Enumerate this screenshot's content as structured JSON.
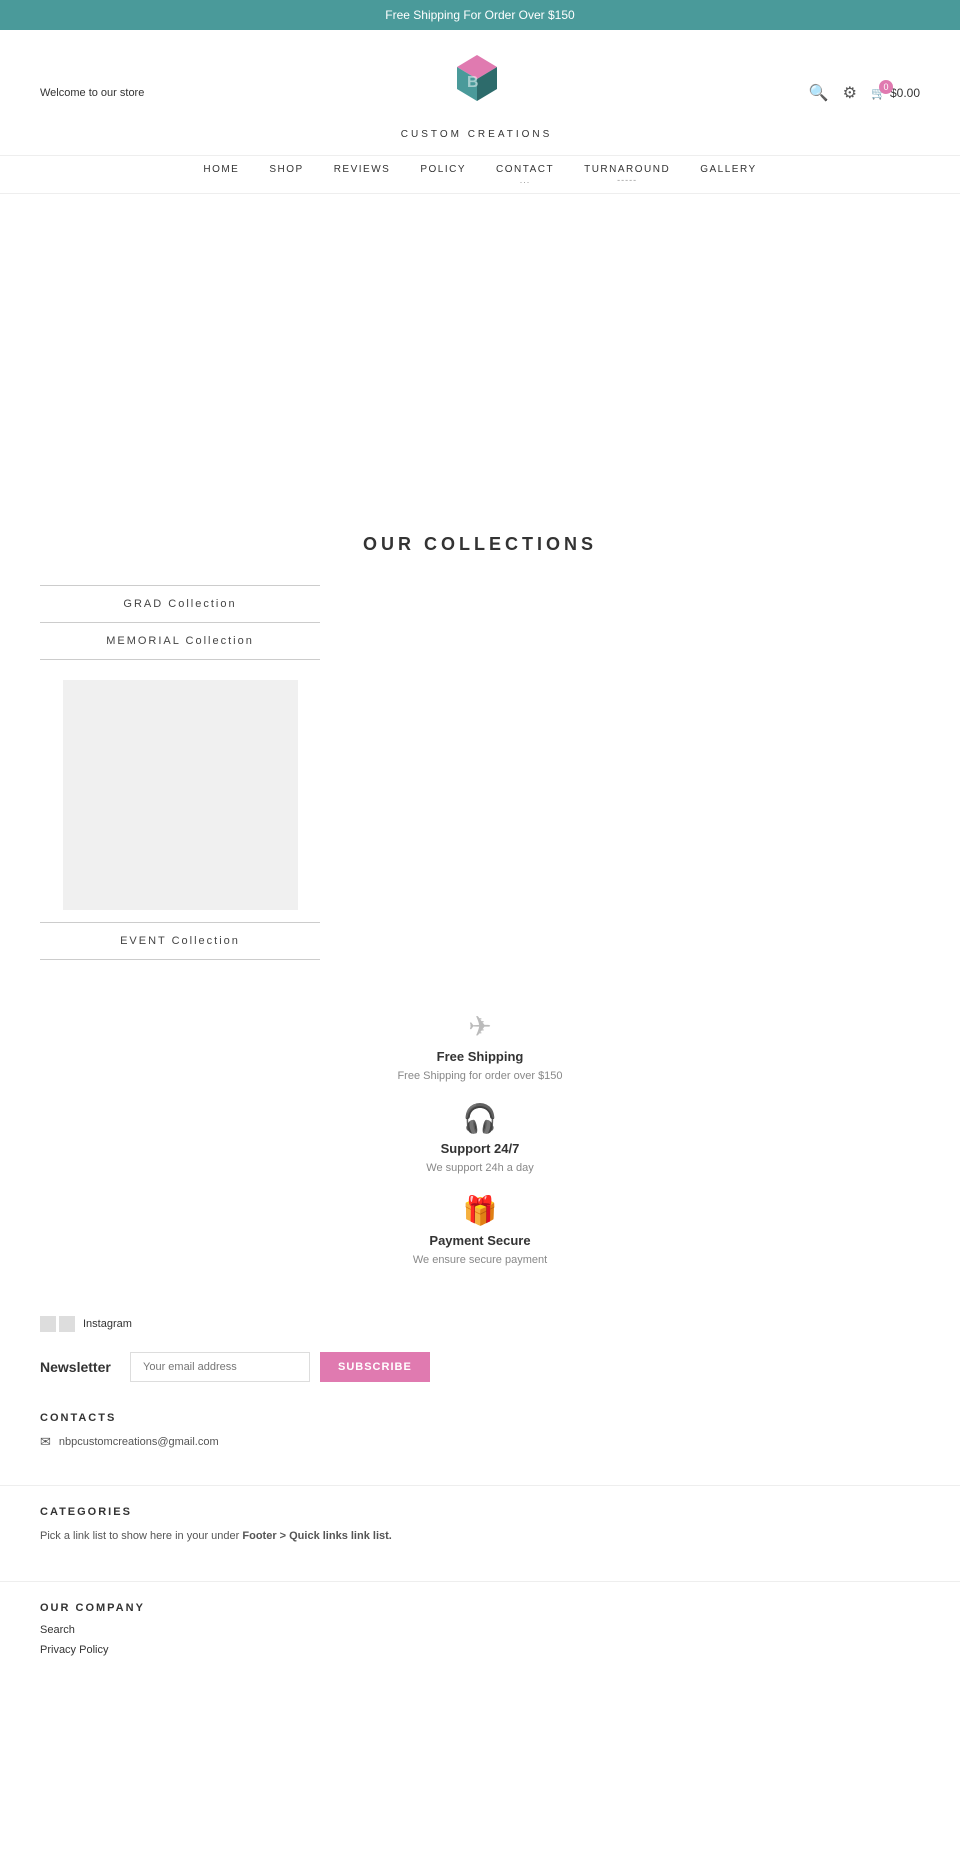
{
  "banner": {
    "text": "Free Shipping For Order Over $150"
  },
  "header": {
    "welcome": "Welcome to our store",
    "logo_text": "CUSTOM CREATIONS",
    "cart_price": "$0.00",
    "cart_count": "0"
  },
  "nav": {
    "items": [
      {
        "label": "HOME",
        "sub": ""
      },
      {
        "label": "SHOP",
        "sub": ""
      },
      {
        "label": "REVIEWS",
        "sub": ""
      },
      {
        "label": "POLICY",
        "sub": ""
      },
      {
        "label": "CONTACT",
        "sub": "..."
      },
      {
        "label": "TURNAROUND",
        "sub": "-----"
      },
      {
        "label": "GALLERY",
        "sub": ""
      }
    ]
  },
  "collections": {
    "title": "OUR COLLECTIONS",
    "items": [
      {
        "label": "GRAD Collection",
        "has_image": false
      },
      {
        "label": "MEMORIAL Collection",
        "has_image": false
      },
      {
        "label": "",
        "has_image": true
      },
      {
        "label": "EVENT Collection",
        "has_image": false
      }
    ]
  },
  "features": [
    {
      "icon": "✈",
      "title": "Free Shipping",
      "desc": "Free Shipping for order over $150"
    },
    {
      "icon": "🎧",
      "title": "Support 24/7",
      "desc": "We support 24h a day"
    },
    {
      "icon": "🎁",
      "title": "Payment Secure",
      "desc": "We ensure secure payment"
    }
  ],
  "footer": {
    "instagram_label": "Instagram",
    "newsletter_label": "Newsletter",
    "newsletter_placeholder": "Your email address",
    "newsletter_button": "SUBSCRIBE",
    "contacts_title": "CONTACTS",
    "contact_email": "nbpcustomcreations@gmail.com",
    "categories_title": "CATEGORIES",
    "categories_text": "Pick a link list to show here in your under Footer > Quick links link list.",
    "company_title": "OUR COMPANY",
    "company_links": [
      "Search",
      "Privacy Policy"
    ]
  }
}
